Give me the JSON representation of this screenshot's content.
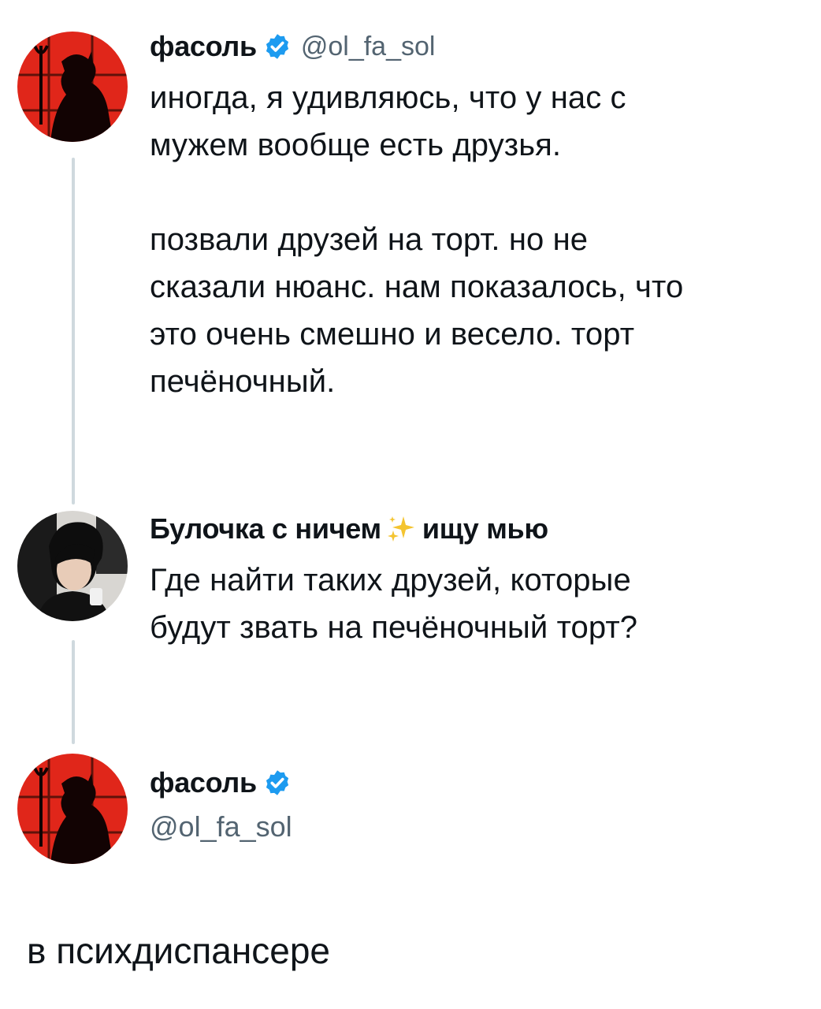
{
  "posts": [
    {
      "author": {
        "name": "фасоль",
        "handle": "@ol_fa_sol",
        "verified": true
      },
      "text": "иногда, я удивляюсь, что у нас с\nмужем вообще есть друзья.\n\nпозвали друзей на торт. но не\nсказали нюанс. нам показалось, что\nэто очень смешно и весело. торт\nпечёночный."
    },
    {
      "author": {
        "name_prefix": "Булочка с ничем",
        "name_suffix": "ищу мью",
        "emoji": "sparkles-icon"
      },
      "text": "Где найти таких друзей, которые\nбудут звать на печёночный торт?"
    },
    {
      "author": {
        "name": "фасоль",
        "handle": "@ol_fa_sol",
        "verified": true
      },
      "text": "в психдиспансере"
    }
  ],
  "colors": {
    "verified": "#1d9bf0",
    "thread_line": "#cfd9de",
    "handle": "#536471",
    "avatar_red": "#e0261a",
    "text": "#0f1419"
  }
}
